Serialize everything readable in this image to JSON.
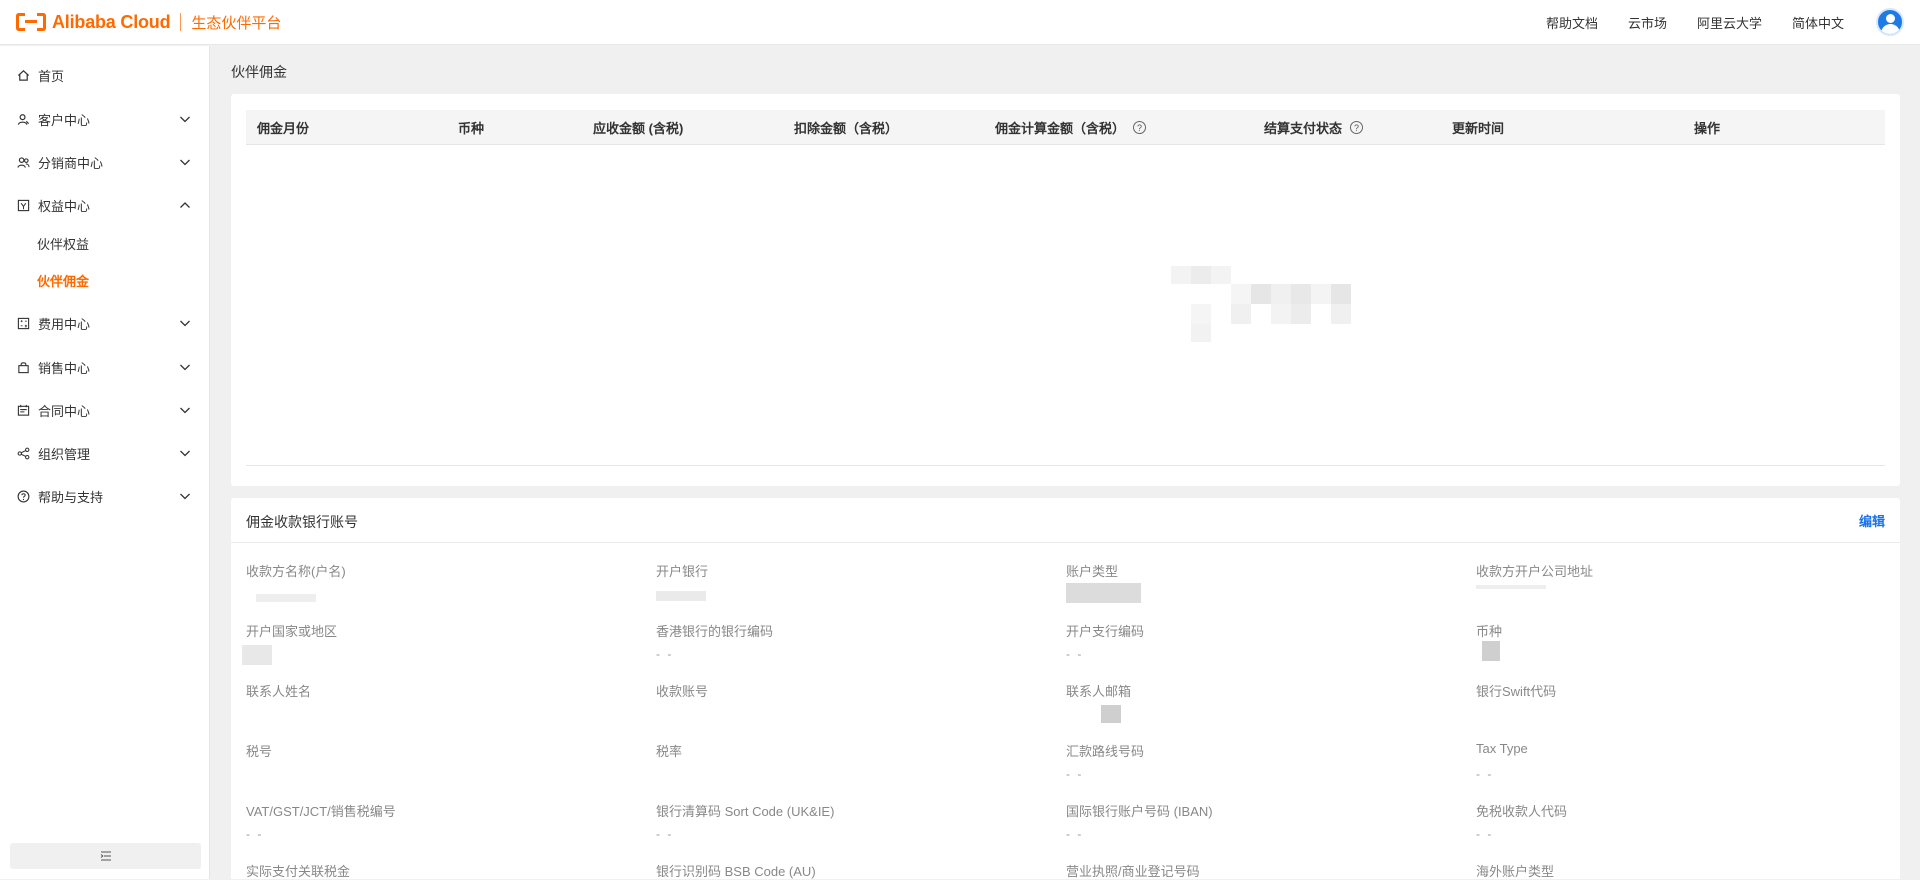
{
  "header": {
    "brand": "Alibaba Cloud",
    "brand_sub": "生态伙伴平台",
    "nav": [
      "帮助文档",
      "云市场",
      "阿里云大学",
      "简体中文"
    ]
  },
  "sidebar": {
    "items": [
      {
        "label": "首页",
        "icon": "home-icon",
        "expandable": false
      },
      {
        "label": "客户中心",
        "icon": "users-icon",
        "expandable": true,
        "expanded": false
      },
      {
        "label": "分销商中心",
        "icon": "group-icon",
        "expandable": true,
        "expanded": false
      },
      {
        "label": "权益中心",
        "icon": "benefit-icon",
        "expandable": true,
        "expanded": true,
        "children": [
          {
            "label": "伙伴权益",
            "active": false
          },
          {
            "label": "伙伴佣金",
            "active": true
          }
        ]
      },
      {
        "label": "费用中心",
        "icon": "calculator-icon",
        "expandable": true,
        "expanded": false
      },
      {
        "label": "销售中心",
        "icon": "bag-icon",
        "expandable": true,
        "expanded": false
      },
      {
        "label": "合同中心",
        "icon": "contract-icon",
        "expandable": true,
        "expanded": false
      },
      {
        "label": "组织管理",
        "icon": "share-icon",
        "expandable": true,
        "expanded": false
      },
      {
        "label": "帮助与支持",
        "icon": "help-icon",
        "expandable": true,
        "expanded": false
      }
    ]
  },
  "main": {
    "page_title": "伙伴佣金",
    "table": {
      "columns": [
        "佣金月份",
        "币种",
        "应收金额 (含税)",
        "扣除金额（含税）",
        "佣金计算金额（含税）",
        "结算支付状态",
        "更新时间",
        "操作"
      ]
    },
    "bank": {
      "title": "佣金收款银行账号",
      "edit_label": "编辑",
      "fields": [
        {
          "label": "收款方名称(户名)",
          "value": ""
        },
        {
          "label": "开户银行",
          "value": ""
        },
        {
          "label": "账户类型",
          "value": ""
        },
        {
          "label": "收款方开户公司地址",
          "value": ""
        },
        {
          "label": "开户国家或地区",
          "value": ""
        },
        {
          "label": "香港银行的银行编码",
          "value": "- -"
        },
        {
          "label": "开户支行编码",
          "value": "- -"
        },
        {
          "label": "币种",
          "value": ""
        },
        {
          "label": "联系人姓名",
          "value": ""
        },
        {
          "label": "收款账号",
          "value": ""
        },
        {
          "label": "联系人邮箱",
          "value": ""
        },
        {
          "label": "银行Swift代码",
          "value": ""
        },
        {
          "label": "税号",
          "value": ""
        },
        {
          "label": "税率",
          "value": ""
        },
        {
          "label": "汇款路线号码",
          "value": "- -"
        },
        {
          "label": "Tax Type",
          "value": "- -"
        },
        {
          "label": "VAT/GST/JCT/销售税编号",
          "value": "- -"
        },
        {
          "label": "银行清算码 Sort Code (UK&IE)",
          "value": "- -"
        },
        {
          "label": "国际银行账户号码 (IBAN)",
          "value": "- -"
        },
        {
          "label": "免税收款人代码",
          "value": "- -"
        },
        {
          "label": "实际支付关联税金",
          "value": ""
        },
        {
          "label": "银行识别码 BSB Code (AU)",
          "value": ""
        },
        {
          "label": "营业执照/商业登记号码",
          "value": ""
        },
        {
          "label": "海外账户类型",
          "value": ""
        }
      ]
    }
  },
  "colors": {
    "accent": "#ff6a00",
    "link": "#1a73e8"
  }
}
